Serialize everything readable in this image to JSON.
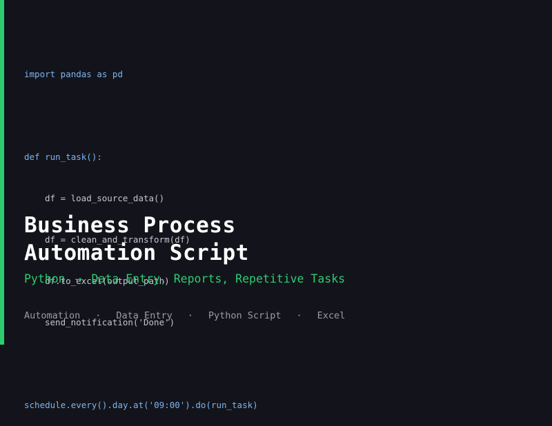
{
  "colors": {
    "background": "#13141b",
    "accent": "#2ecc71",
    "code_keyword": "#7fb3f0",
    "code_text": "#c3c6d0",
    "title": "#ffffff",
    "tags": "#9a9ca8"
  },
  "code": {
    "lines": [
      "import pandas as pd",
      "",
      "def run_task():",
      "df = load_source_data()",
      "df = clean_and_transform(df)",
      "df.to_excel(output_path)",
      "send_notification('Done')",
      "",
      "schedule.every().day.at('09:00').do(run_task)"
    ]
  },
  "title": {
    "line1": "Business Process",
    "line2": "Automation Script"
  },
  "subtitle": {
    "language": "Python",
    "arrow": "→",
    "targets": "Data Entry, Reports, Repetitive Tasks"
  },
  "tags": {
    "separator": "·",
    "items": [
      "Automation",
      "Data Entry",
      "Python Script",
      "Excel"
    ]
  }
}
